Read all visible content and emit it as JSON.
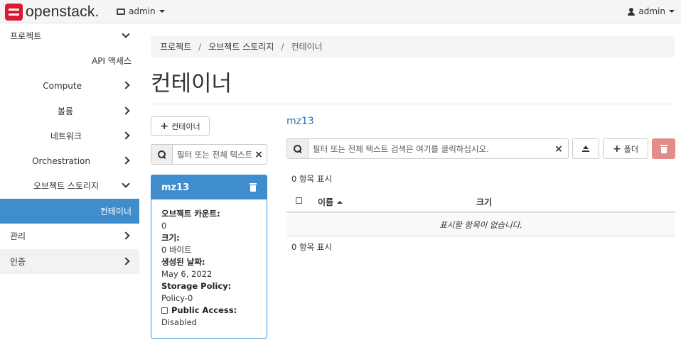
{
  "navbar": {
    "brand": "openstack.",
    "project_menu": "admin",
    "user_menu": "admin"
  },
  "sidebar": {
    "items": [
      {
        "label": "프로젝트",
        "state": "expanded"
      },
      {
        "label": "API 액세스",
        "state": "none"
      },
      {
        "label": "Compute",
        "state": "collapsed"
      },
      {
        "label": "볼륨",
        "state": "collapsed"
      },
      {
        "label": "네트워크",
        "state": "collapsed"
      },
      {
        "label": "Orchestration",
        "state": "collapsed"
      },
      {
        "label": "오브젝트 스토리지",
        "state": "expanded"
      },
      {
        "label": "컨테이너",
        "state": "active"
      },
      {
        "label": "관리",
        "state": "collapsed"
      },
      {
        "label": "인증",
        "state": "collapsed"
      }
    ]
  },
  "breadcrumb": [
    "프로젝트",
    "오브젝트 스토리지",
    "컨테이너"
  ],
  "page_title": "컨테이너",
  "left_panel": {
    "create_container_label": "컨테이너",
    "filter_placeholder": "필터 또는 전체 텍스트"
  },
  "container_card": {
    "name": "mz13",
    "object_count_label": "오브젝트 카운트:",
    "object_count": "0",
    "size_label": "크기:",
    "size": "0 바이트",
    "created_label": "생성된 날짜:",
    "created": "May 6, 2022",
    "policy_label": "Storage Policy:",
    "policy": "Policy-0",
    "public_access_label": "Public Access:",
    "public_access": "Disabled"
  },
  "right_panel": {
    "container_name": "mz13",
    "filter_placeholder": "필터 또는 전체 텍스트 검색은 여기를 클릭하십시오.",
    "folder_button_label": "폴더",
    "count_top": "0 항목 표시",
    "count_bottom": "0 항목 표시",
    "columns": {
      "name": "이름",
      "size": "크기"
    },
    "empty_message": "표시할 항목이 없습니다."
  },
  "colors": {
    "accent": "#3f8dcc",
    "brand": "#da1a32",
    "danger": "#e38d8a",
    "link": "#2a73b8"
  }
}
